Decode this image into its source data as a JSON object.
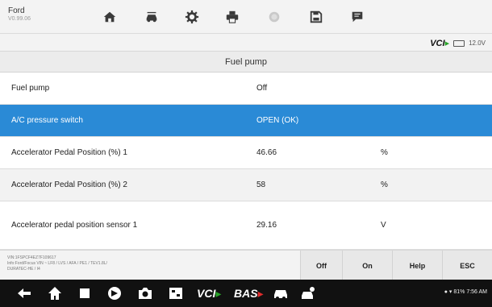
{
  "header": {
    "brand": "Ford",
    "version": "V0.99.06"
  },
  "vci": {
    "label": "VCI",
    "voltage": "12.0V"
  },
  "section_title": "Fuel pump",
  "rows": [
    {
      "name": "Fuel pump",
      "value": "Off",
      "unit": ""
    },
    {
      "name": "A/C pressure switch",
      "value": "OPEN (OK)",
      "unit": ""
    },
    {
      "name": "Accelerator Pedal Position (%) 1",
      "value": "46.66",
      "unit": "%"
    },
    {
      "name": "Accelerator Pedal Position (%) 2",
      "value": "58",
      "unit": "%"
    },
    {
      "name": "Accelerator pedal position sensor 1",
      "value": "29.16",
      "unit": "V"
    }
  ],
  "selected_row": 1,
  "vehicle_info": {
    "line1": "VIN:1FSPCF4EZ7F109617",
    "line2": "Info:Ford/Focus VIN ~ LF8 / LVS / AFA / PE1 / TEV1.8L/",
    "line3": "DURATEC-HE / I4"
  },
  "buttons": {
    "off": "Off",
    "on": "On",
    "help": "Help",
    "esc": "ESC"
  },
  "navbar": {
    "vci": "VCI",
    "bas": "BAS",
    "status": "81% 7:56 AM"
  },
  "colors": {
    "accent": "#2a8ad6",
    "navbar": "#111111"
  }
}
